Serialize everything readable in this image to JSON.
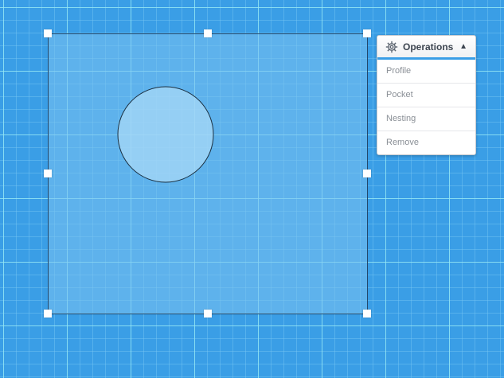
{
  "canvas": {
    "shape_fill": "#7cc3f0",
    "shape_stroke": "#23486b",
    "circle_fill": "#a8d8f7",
    "circle_stroke": "#1a2f40",
    "handle_color": "#ffffff"
  },
  "operations_menu": {
    "icon": "gear-icon",
    "title": "Operations",
    "caret": "▲",
    "items": [
      {
        "label": "Profile"
      },
      {
        "label": "Pocket"
      },
      {
        "label": "Nesting"
      },
      {
        "label": "Remove"
      }
    ]
  }
}
